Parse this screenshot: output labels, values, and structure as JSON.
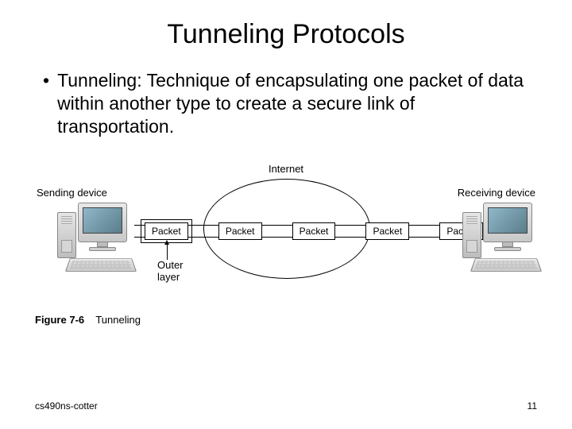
{
  "title": "Tunneling Protocols",
  "bullet": "Tunneling: Technique of encapsulating one packet of data within another type to create a secure link of transportation.",
  "figure": {
    "internet_label": "Internet",
    "sending_label": "Sending device",
    "receiving_label": "Receiving device",
    "outer_layer_label_line1": "Outer",
    "outer_layer_label_line2": "layer",
    "packets": [
      "Packet",
      "Packet",
      "Packet",
      "Packet",
      "Packet"
    ],
    "caption_number": "Figure 7-6",
    "caption_text": "Tunneling"
  },
  "footer": {
    "left": "cs490ns-cotter",
    "right": "11"
  }
}
